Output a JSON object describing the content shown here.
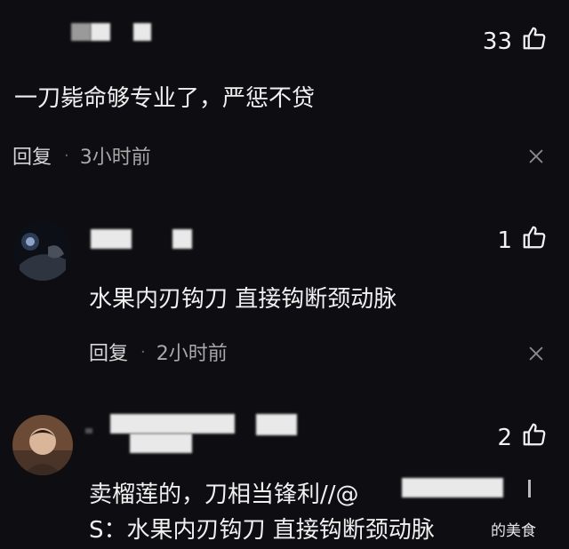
{
  "comments": [
    {
      "like_count": "33",
      "text": "一刀毙命够专业了，严惩不贷",
      "reply_label": "回复",
      "separator": "·",
      "time": "3小时前"
    },
    {
      "like_count": "1",
      "text": "水果内刃钩刀 直接钩断颈动脉",
      "reply_label": "回复",
      "separator": "·",
      "time": "2小时前"
    },
    {
      "like_count": "2",
      "text_line1": "卖榴莲的，刀相当锋利//@",
      "text_line2": "S：水果内刃钩刀 直接钩断颈动脉"
    }
  ],
  "watermark": "的美食",
  "icons": {
    "like": "thumbs-up-icon",
    "close": "close-icon"
  },
  "colors": {
    "background": "#0e0e12",
    "text": "#f0f0f0",
    "meta": "#a9a9a9"
  }
}
